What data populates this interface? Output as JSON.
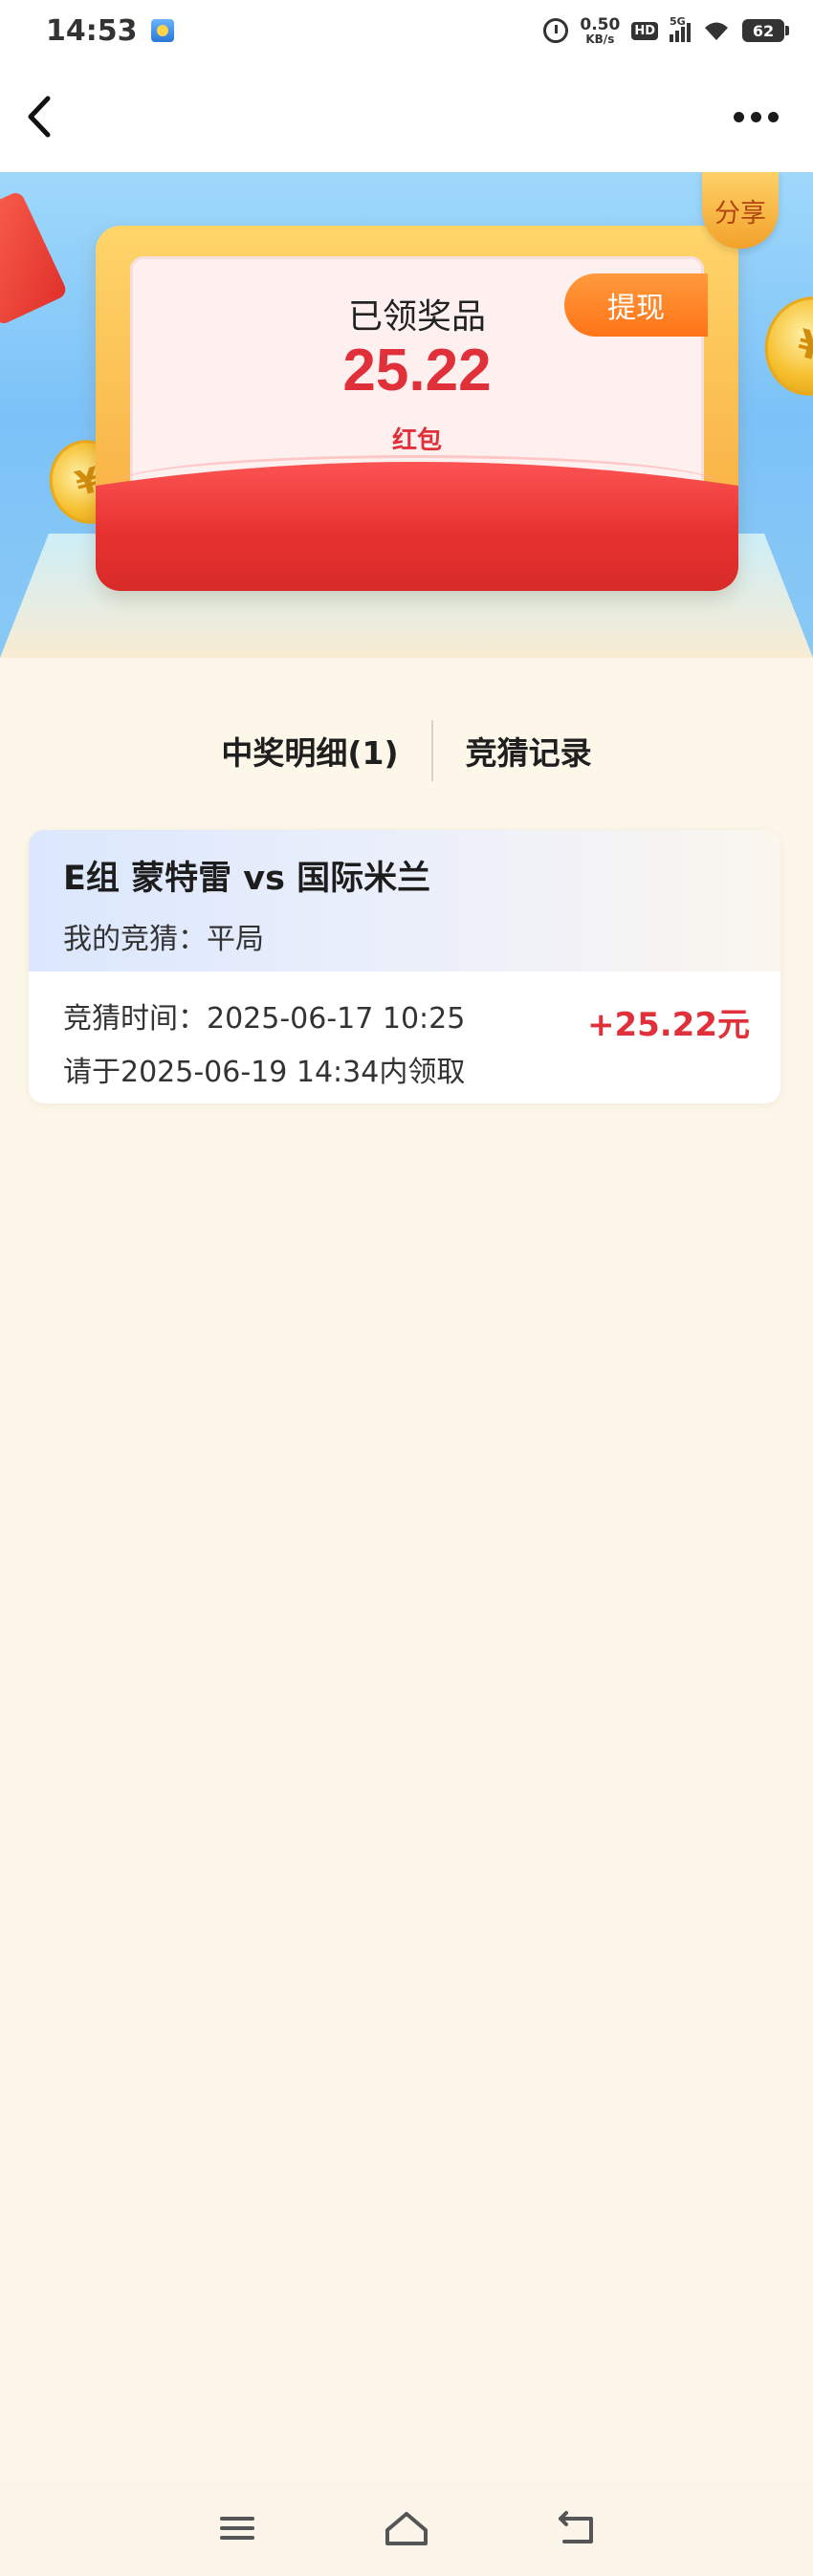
{
  "status_bar": {
    "time": "14:53",
    "net_speed_value": "0.50",
    "net_speed_unit": "KB/s",
    "hd_label": "HD",
    "network_type": "5G",
    "battery": "62"
  },
  "hero": {
    "share_label": "分享",
    "title": "已领奖品",
    "amount": "25.22",
    "unit": "红包",
    "withdraw_label": "提现",
    "coin_symbol": "¥"
  },
  "tabs": [
    {
      "label": "中奖明细(1)"
    },
    {
      "label": "竞猜记录"
    }
  ],
  "records": [
    {
      "match": "E组 蒙特雷 vs 国际米兰",
      "my_guess": "我的竞猜：平局",
      "guess_time": "竞猜时间：2025-06-17 10:25",
      "deadline": "请于2025-06-19 14:34内领取",
      "reward": "+25.22元"
    }
  ],
  "colors": {
    "accent_red": "#e0303a",
    "accent_orange": "#ff7418",
    "page_bg": "#fdf7ea"
  },
  "icons": [
    "back-icon",
    "more-icon",
    "menu-icon",
    "home-icon",
    "return-icon"
  ]
}
